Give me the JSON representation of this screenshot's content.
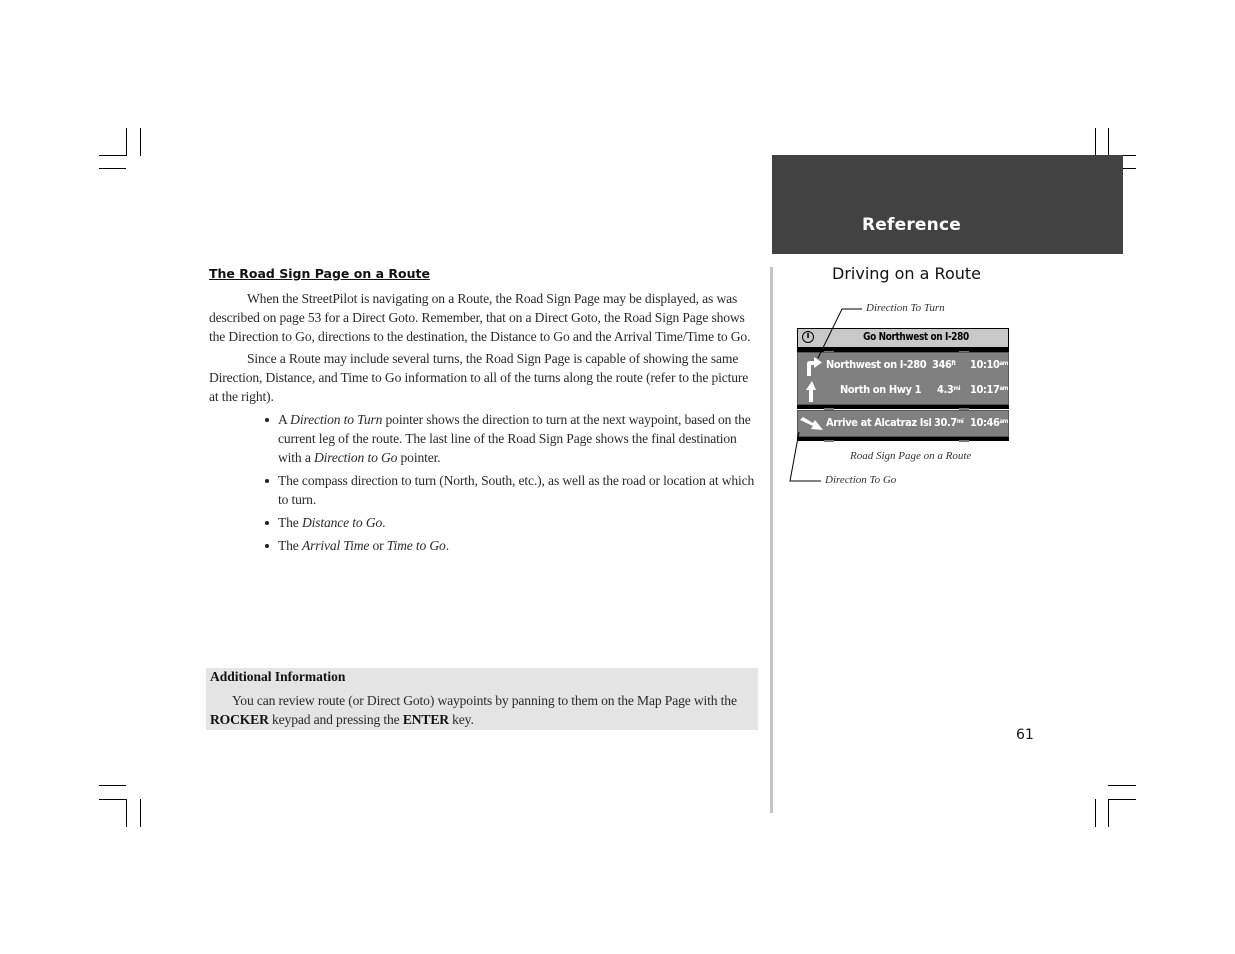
{
  "header": {
    "section": "Reference"
  },
  "left": {
    "title": "The Road Sign Page on a Route",
    "paragraphs": [
      "When the StreetPilot is navigating on a Route, the Road Sign Page may be displayed, as was described on page 53 for a Direct Goto.  Remember, that on a Direct Goto, the Road Sign Page shows the Direction to Go, directions to the destination, the Distance to Go and the Arrival Time/Time to Go.",
      "Since a Route may include several turns, the Road Sign Page is capable of showing the same Direction, Distance, and Time to Go information to all of the turns along the route (refer to the picture at the right)."
    ],
    "bullets": [
      {
        "pre": "A ",
        "em": "Direction to Turn",
        "mid": " pointer shows the direction to turn at the next waypoint, based on the current leg of the route.  The last line of the Road Sign Page shows the final destination with a ",
        "em2": "Direction to Go",
        "post": " pointer."
      },
      {
        "text": "The compass direction to turn (North, South, etc.), as well as the road or location at which to turn."
      },
      {
        "pre": "The ",
        "em": "Distance to Go",
        "post": "."
      },
      {
        "pre": "The ",
        "em": "Arrival Time",
        "mid": " or ",
        "em2": "Time to Go",
        "post": "."
      }
    ],
    "info_box": {
      "title": "Additional Information",
      "text_pre": "You can review route (or Direct Goto) waypoints by panning to them on the Map Page with the ",
      "key1": "ROCKER",
      "text_mid": " keypad and pressing the ",
      "key2": "ENTER",
      "text_post": " key."
    }
  },
  "right": {
    "title": "Driving on a Route",
    "callouts": {
      "direction_to_turn": "Direction To Turn",
      "direction_to_go": "Direction To Go"
    },
    "caption": "Road Sign Page on a Route",
    "screen": {
      "header_icon": "info-icon",
      "header_text": "Go Northwest on I-280",
      "rows": [
        {
          "icon": "turn-right-arrow",
          "name": "Northwest on I-280",
          "distance": "346",
          "distance_unit": "ft",
          "time": "10:10",
          "time_unit": "am"
        },
        {
          "icon": "straight-arrow",
          "name": "North on Hwy 1",
          "distance": "4.3",
          "distance_unit": "mi",
          "time": "10:17",
          "time_unit": "am"
        }
      ],
      "destination": {
        "icon": "direction-to-go-arrow",
        "name": "Arrive at Alcatraz Isl",
        "distance": "30.7",
        "distance_unit": "mi",
        "time": "10:46",
        "time_unit": "am"
      }
    }
  },
  "footer": {
    "page_number": "61"
  },
  "colors": {
    "band": "#424242",
    "divider": "#c4c4c4",
    "info_box": "#e4e4e4",
    "screen_panel": "#808080",
    "screen_header": "#c8c8c8"
  }
}
